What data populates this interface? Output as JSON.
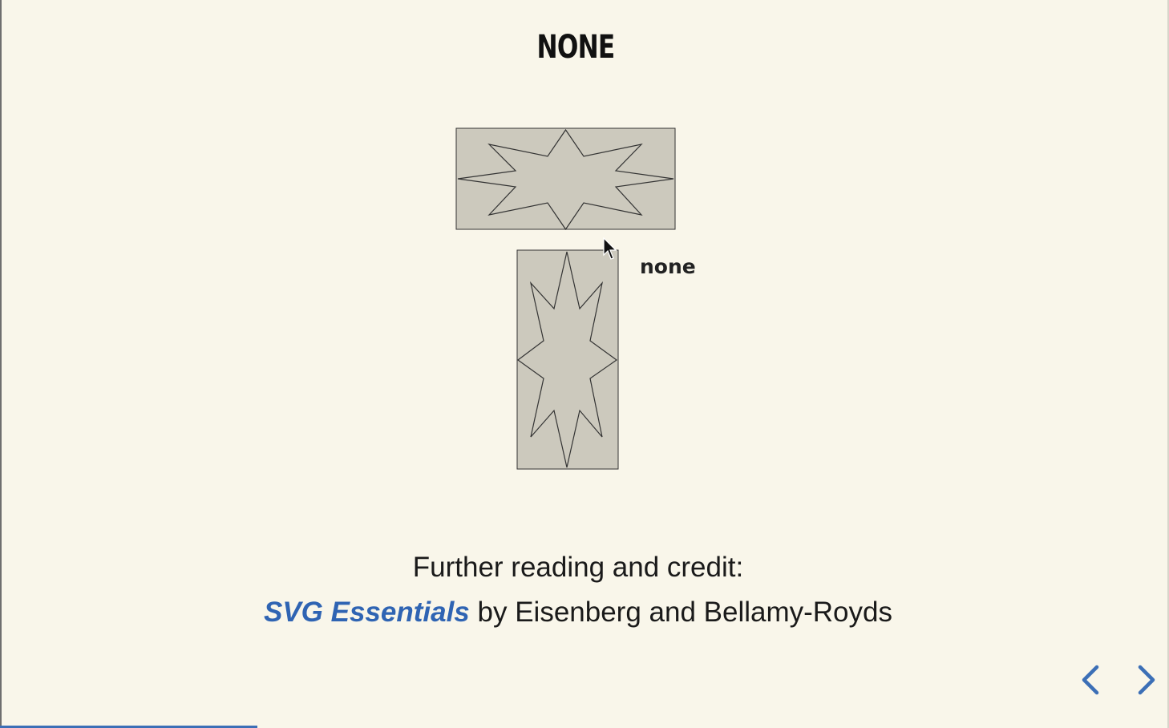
{
  "slide": {
    "title": "NONE",
    "figure_label": "none",
    "credit": {
      "heading": "Further reading and credit:",
      "book_title": "SVG Essentials",
      "byline": " by Eisenberg and Bellamy-Royds"
    }
  },
  "navigation": {
    "prev_icon": "chevron-left-icon",
    "next_icon": "chevron-right-icon"
  },
  "colors": {
    "background": "#f9f6ea",
    "shape_fill": "#ccc9bd",
    "shape_stroke": "#333333",
    "link": "#2f64b3",
    "nav_arrow": "#3c6fb6"
  },
  "progress": {
    "fraction": 0.22
  }
}
